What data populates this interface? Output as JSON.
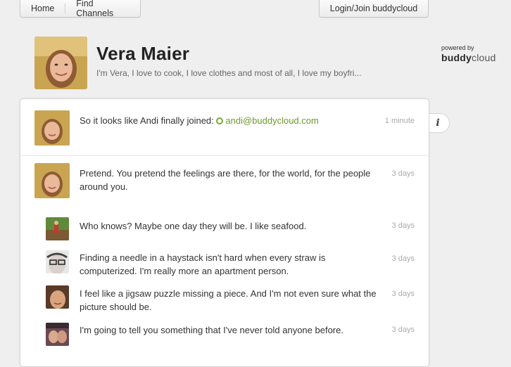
{
  "nav": {
    "home": "Home",
    "find_channels": "Find Channels",
    "login": "Login/Join buddycloud"
  },
  "profile": {
    "name": "Vera Maier",
    "bio": "I'm Vera, I love to cook, I love clothes and most of all, I love my boyfri..."
  },
  "branding": {
    "powered_by": "powered by",
    "brand_bold": "buddy",
    "brand_light": "cloud"
  },
  "posts": [
    {
      "text": "So it looks like Andi finally joined: ",
      "mention": "andi@buddycloud.com",
      "time": "1 minute"
    },
    {
      "text": "Pretend. You pretend the feelings are there, for the world, for the people around you.",
      "time": "3 days",
      "replies": [
        {
          "text": "Who knows? Maybe one day they will be. I like seafood.",
          "time": "3 days"
        },
        {
          "text": "Finding a needle in a haystack isn't hard when every straw is computerized. I'm really more an apartment person.",
          "time": "3 days"
        },
        {
          "text": "I feel like a jigsaw puzzle missing a piece. And I'm not even sure what the picture should be.",
          "time": "3 days"
        },
        {
          "text": "I'm going to tell you something that I've never told anyone before.",
          "time": "3 days"
        }
      ]
    }
  ],
  "colors": {
    "accent_green": "#6e9a2f",
    "background": "#efefef"
  }
}
